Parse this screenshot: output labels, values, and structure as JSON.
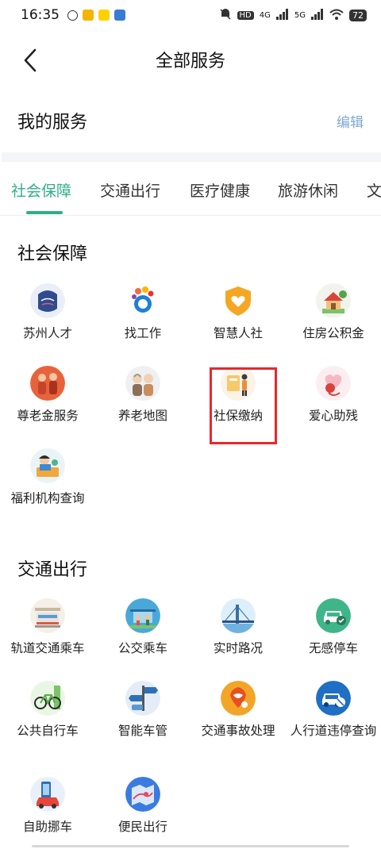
{
  "status_bar": {
    "time": "16:35",
    "network_label": "4G",
    "network2_label": "5G",
    "battery": "72",
    "hd_label": "HD"
  },
  "header": {
    "title": "全部服务"
  },
  "my_services": {
    "title": "我的服务",
    "edit_label": "编辑"
  },
  "tabs": [
    {
      "label": "社会保障",
      "active": true
    },
    {
      "label": "交通出行",
      "active": false
    },
    {
      "label": "医疗健康",
      "active": false
    },
    {
      "label": "旅游休闲",
      "active": false
    },
    {
      "label": "文",
      "active": false
    }
  ],
  "sections": [
    {
      "title": "社会保障",
      "items": [
        {
          "label": "苏州人才",
          "icon": "talent-icon"
        },
        {
          "label": "找工作",
          "icon": "job-icon"
        },
        {
          "label": "智慧人社",
          "icon": "shield-heart-icon"
        },
        {
          "label": "住房公积金",
          "icon": "house-icon"
        },
        {
          "label": "尊老金服务",
          "icon": "elderly-icon"
        },
        {
          "label": "养老地图",
          "icon": "elderly-couple-icon"
        },
        {
          "label": "社保缴纳",
          "icon": "payment-icon"
        },
        {
          "label": "爱心助残",
          "icon": "care-icon"
        },
        {
          "label": "福利机构查询",
          "icon": "welfare-icon"
        }
      ]
    },
    {
      "title": "交通出行",
      "items": [
        {
          "label": "轨道交通乘车",
          "icon": "metro-icon"
        },
        {
          "label": "公交乘车",
          "icon": "bus-icon"
        },
        {
          "label": "实时路况",
          "icon": "bridge-icon"
        },
        {
          "label": "无感停车",
          "icon": "parking-icon"
        },
        {
          "label": "公共自行车",
          "icon": "bicycle-icon"
        },
        {
          "label": "智能车管",
          "icon": "signpost-icon"
        },
        {
          "label": "交通事故处理",
          "icon": "accident-icon"
        },
        {
          "label": "人行道违停查询",
          "icon": "no-parking-icon"
        },
        {
          "label": "自助挪车",
          "icon": "move-car-icon"
        },
        {
          "label": "便民出行",
          "icon": "map-icon"
        }
      ]
    }
  ],
  "colors": {
    "accent": "#2eaf86",
    "edit": "#7ea8cf",
    "highlight": "#e8282c"
  }
}
